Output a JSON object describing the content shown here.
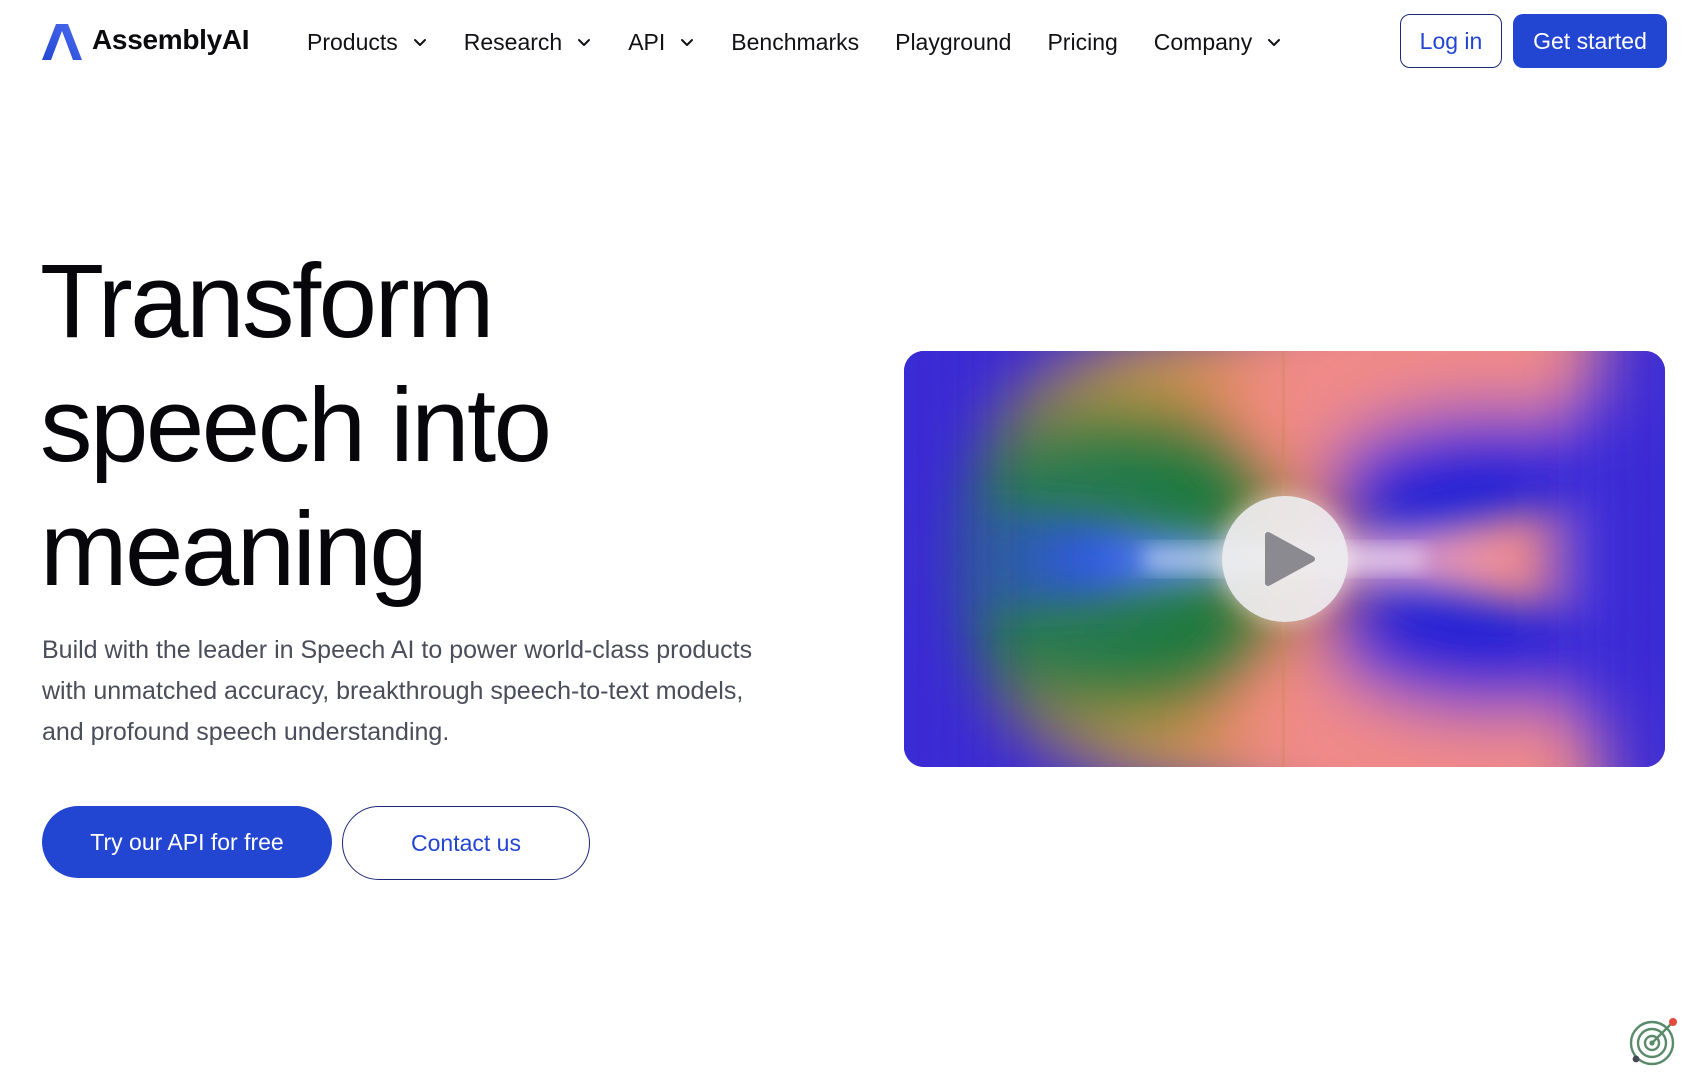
{
  "brand": {
    "name": "AssemblyAI",
    "logo_icon": "assemblyai-logo-icon",
    "accent_color": "#2346d2"
  },
  "nav": {
    "items": [
      {
        "label": "Products",
        "has_dropdown": true
      },
      {
        "label": "Research",
        "has_dropdown": true
      },
      {
        "label": "API",
        "has_dropdown": true
      },
      {
        "label": "Benchmarks",
        "has_dropdown": false
      },
      {
        "label": "Playground",
        "has_dropdown": false
      },
      {
        "label": "Pricing",
        "has_dropdown": false
      },
      {
        "label": "Company",
        "has_dropdown": true
      }
    ],
    "login_label": "Log in",
    "get_started_label": "Get started"
  },
  "hero": {
    "title_lines": [
      "Transform",
      "speech into",
      "meaning"
    ],
    "subtitle_lines": [
      "Build with the leader in Speech AI to power world-class products",
      "with unmatched accuracy, breakthrough speech-to-text models,",
      "and profound speech understanding."
    ],
    "primary_cta": "Try our API for free",
    "secondary_cta": "Contact us"
  },
  "video": {
    "play_icon": "play-icon"
  },
  "widget": {
    "icon": "radar-icon"
  }
}
